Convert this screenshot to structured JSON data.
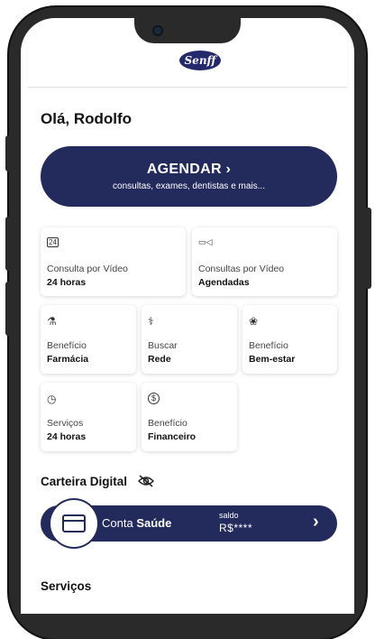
{
  "header": {
    "logo_text": "Senff"
  },
  "greeting": "Olá, Rodolfo",
  "agendar": {
    "title": "AGENDAR ›",
    "subtitle": "consultas, exames, dentistas e mais..."
  },
  "cards": [
    {
      "icon": "calendar-24-icon",
      "icon_glyph": "24",
      "line1": "Consulta por Vídeo",
      "line2": "24 horas"
    },
    {
      "icon": "video-camera-icon",
      "icon_glyph": "▭◁",
      "line1": "Consultas por Vídeo",
      "line2": "Agendadas"
    },
    {
      "icon": "pills-icon",
      "icon_glyph": "⚗",
      "line1": "Benefício",
      "line2": "Farmácia"
    },
    {
      "icon": "stethoscope-icon",
      "icon_glyph": "⚕",
      "line1": "Buscar",
      "line2": "Rede"
    },
    {
      "icon": "lotus-icon",
      "icon_glyph": "❀",
      "line1": "Benefício",
      "line2": "Bem-estar"
    },
    {
      "icon": "clock-icon",
      "icon_glyph": "◷",
      "line1": "Serviços",
      "line2": "24 horas"
    },
    {
      "icon": "dollar-coin-icon",
      "icon_glyph": "$",
      "line1": "Benefício",
      "line2": "Financeiro"
    }
  ],
  "wallet": {
    "section_title": "Carteira Digital",
    "visibility_icon": "eye-off-icon",
    "account_prefix": "Conta",
    "account_name": "Saúde",
    "balance_label": "saldo",
    "balance_value": "R$****",
    "chevron": "›"
  },
  "services_title": "Serviços",
  "colors": {
    "primary": "#232a5c",
    "frame": "#2a2a2a"
  }
}
